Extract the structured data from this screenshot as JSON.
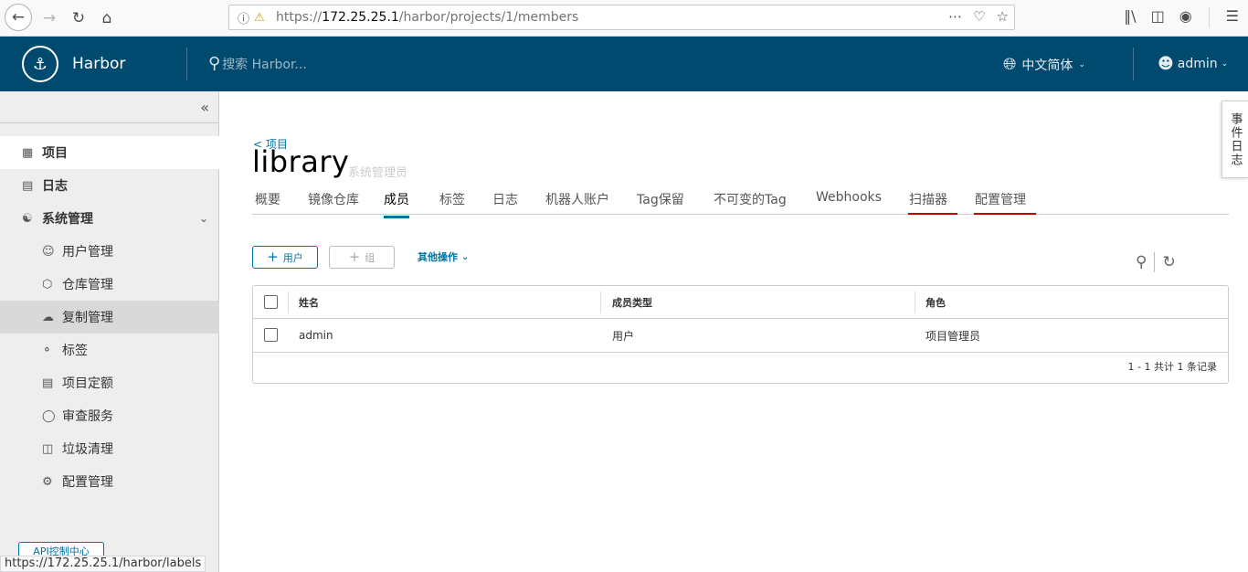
{
  "browser": {
    "url_prefix": "https://",
    "url_host": "172.25.25.1",
    "url_path": "/harbor/projects/1/members",
    "status_url": "https://172.25.25.1/harbor/labels"
  },
  "header": {
    "brand": "Harbor",
    "search_placeholder": "搜索 Harbor...",
    "language": "中文简体",
    "user": "admin"
  },
  "sidebar": {
    "items": [
      {
        "label": "项目",
        "icon": "projects-icon"
      },
      {
        "label": "日志",
        "icon": "logs-icon"
      },
      {
        "label": "系统管理",
        "icon": "administration-icon"
      },
      {
        "label": "用户管理",
        "icon": "users-icon"
      },
      {
        "label": "仓库管理",
        "icon": "registry-icon"
      },
      {
        "label": "复制管理",
        "icon": "replication-icon"
      },
      {
        "label": "标签",
        "icon": "tag-icon"
      },
      {
        "label": "项目定额",
        "icon": "quota-icon"
      },
      {
        "label": "审查服务",
        "icon": "shield-icon"
      },
      {
        "label": "垃圾清理",
        "icon": "trash-icon"
      },
      {
        "label": "配置管理",
        "icon": "gear-icon"
      }
    ],
    "api_button": "API控制中心"
  },
  "main": {
    "back_link": "< 项目",
    "project_name": "library",
    "project_role": "系统管理员",
    "tabs": [
      "概要",
      "镜像仓库",
      "成员",
      "标签",
      "日志",
      "机器人账户",
      "Tag保留",
      "不可变的Tag",
      "Webhooks",
      "扫描器",
      "配置管理"
    ],
    "active_tab": "成员",
    "add_user_label": "用户",
    "add_group_label": "组",
    "more_actions_label": "其他操作",
    "table": {
      "columns": [
        "姓名",
        "成员类型",
        "角色"
      ],
      "rows": [
        {
          "name": "admin",
          "type": "用户",
          "role": "项目管理员"
        }
      ],
      "footer": "1 - 1 共计 1 条记录"
    }
  },
  "event_log_tab": "事件日志",
  "colors": {
    "header_bg": "#004a70",
    "accent": "#0072a3",
    "highlight_underline": "#cc0000"
  }
}
